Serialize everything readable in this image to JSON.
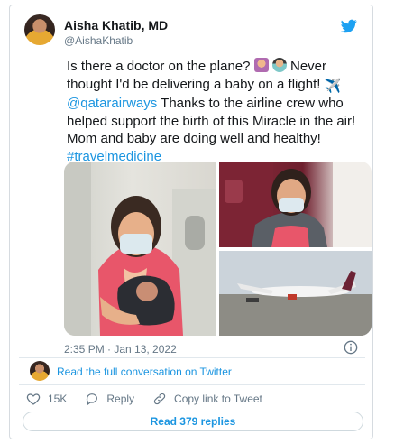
{
  "tweet": {
    "author_name": "Aisha Khatib, MD",
    "author_handle": "@AishaKhatib",
    "text": {
      "line1_a": "Is there a doctor on the plane? ",
      "line1_b": " Never thought",
      "line2": "I'd be delivering a baby on a flight! ",
      "mention": "@qatarairways",
      "line3_rest": " Thanks to the airline crew who helped support the birth of this Miracle in the air! Mom and baby are doing well and healthy!",
      "hashtag": "#travelmedicine"
    },
    "timestamp": "2:35 PM · Jan 13, 2022",
    "read_full_conversation": "Read the full conversation on Twitter",
    "likes_count": "15K",
    "reply_label": "Reply",
    "copy_link_label": "Copy link to Tweet",
    "read_replies_label": "Read 379 replies"
  },
  "icons": {
    "brand": "twitter-bird-icon",
    "info": "info-icon",
    "like": "heart-icon",
    "reply": "reply-icon",
    "copy_link": "link-icon"
  },
  "colors": {
    "link_blue": "#1b95e0",
    "secondary_text": "#657786",
    "primary_text": "#14171a"
  }
}
